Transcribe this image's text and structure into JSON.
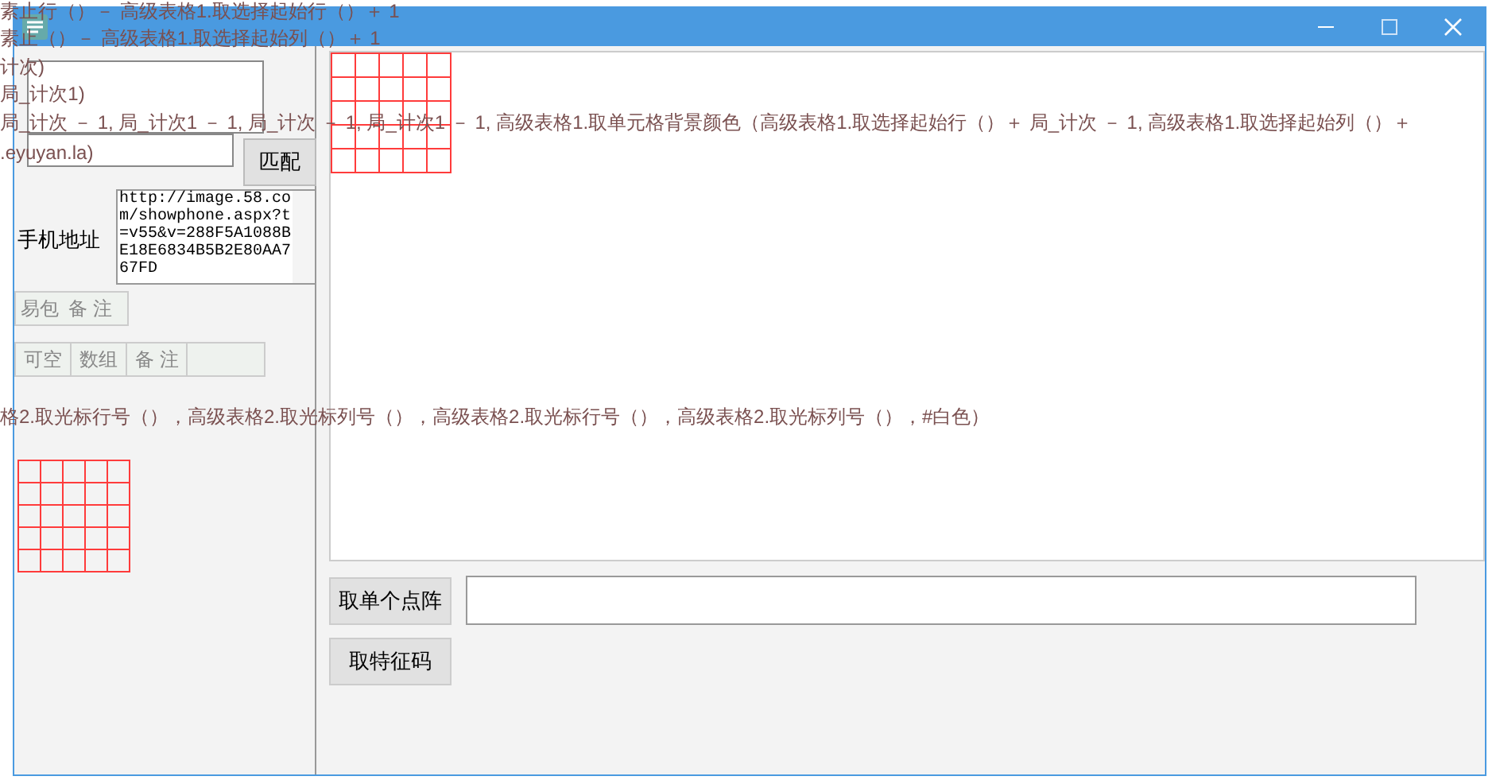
{
  "code_lines": [
    {
      "text": "素止行（）－ 高级表格1.取选择起始行（）＋ 1"
    },
    {
      "text": "素止（）－ 高级表格1.取选择起始列（）＋ 1"
    },
    {
      "text": "计次)"
    },
    {
      "text": "局_计次1)"
    },
    {
      "text": "局_计次 － 1, 局_计次1 － 1, 局_计次 － 1, 局_计次1 － 1, 高级表格1.取单元格背景颜色（高级表格1.取选择起始行（）＋ 局_计次 － 1, 高级表格1.取选择起始列（）＋"
    },
    {
      "text": ".eyuyan.la)"
    },
    {
      "text": "格2.取光标行号（），高级表格2.取光标列号（），高级表格2.取光标行号（），高级表格2.取光标列号（），#白色）"
    }
  ],
  "left_panel": {
    "match_button": "匹配",
    "phone_label": "手机地址",
    "url_value": "http://image.58.com/showphone.aspx?t=v55&v=288F5A1088BE18E6834B5B2E80AA767FD",
    "table1_headers": [
      "易包",
      "备 注"
    ],
    "table2_headers": [
      "可空",
      "数组",
      "备 注"
    ]
  },
  "bottom": {
    "dot_button": "取单个点阵",
    "feature_button": "取特征码"
  }
}
